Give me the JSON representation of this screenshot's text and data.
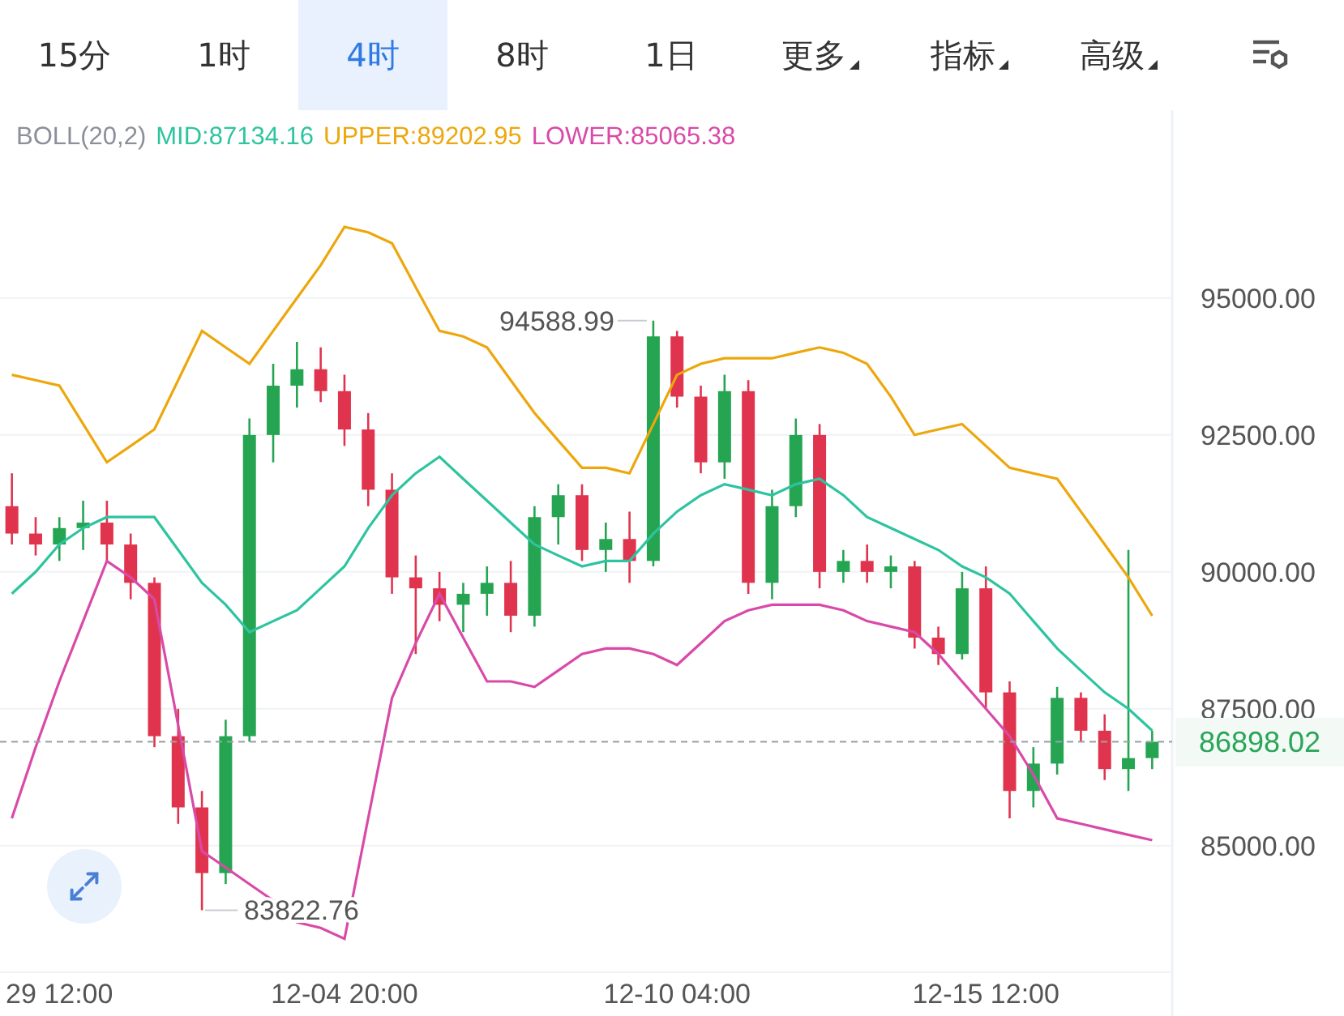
{
  "toolbar": {
    "tabs": [
      {
        "label": "15分",
        "kind": "interval",
        "selected": false
      },
      {
        "label": "1时",
        "kind": "interval",
        "selected": false
      },
      {
        "label": "4时",
        "kind": "interval",
        "selected": true
      },
      {
        "label": "8时",
        "kind": "interval",
        "selected": false
      },
      {
        "label": "1日",
        "kind": "interval",
        "selected": false
      },
      {
        "label": "更多",
        "kind": "dropdown",
        "selected": false
      },
      {
        "label": "指标",
        "kind": "dropdown",
        "selected": false
      },
      {
        "label": "高级",
        "kind": "dropdown",
        "selected": false
      }
    ]
  },
  "indicator_legend": {
    "title": "BOLL(20,2)",
    "series_values": [
      ":87134.16",
      ":89202.95",
      ":85065.38"
    ]
  },
  "chart": {
    "chart_data": {
      "type": "candlestick",
      "grid": true,
      "categories": [
        null,
        null,
        "29 12:00",
        null,
        null,
        null,
        null,
        null,
        null,
        null,
        null,
        null,
        null,
        null,
        "12-04 20:00",
        null,
        null,
        null,
        null,
        null,
        null,
        null,
        null,
        null,
        null,
        null,
        null,
        null,
        "12-10 04:00",
        null,
        null,
        null,
        null,
        null,
        null,
        null,
        null,
        null,
        null,
        null,
        null,
        "12-15 12:00",
        null,
        null,
        null,
        null,
        null,
        null,
        null
      ],
      "ylim": [
        82690,
        98430
      ],
      "yticks": [
        {
          "value": 95000,
          "label": "95000.00"
        },
        {
          "value": 92500,
          "label": "92500.00"
        },
        {
          "value": 90000,
          "label": "90000.00"
        },
        {
          "value": 87500,
          "label": "87500.00"
        },
        {
          "value": 85000,
          "label": "85000.00"
        }
      ],
      "ohlc": [
        [
          91200,
          91800,
          90500,
          90700
        ],
        [
          90700,
          91000,
          90300,
          90500
        ],
        [
          90500,
          91000,
          90200,
          90800
        ],
        [
          90800,
          91300,
          90400,
          90900
        ],
        [
          90900,
          91300,
          90200,
          90500
        ],
        [
          90500,
          90700,
          89500,
          89800
        ],
        [
          89800,
          89900,
          86800,
          87000
        ],
        [
          87000,
          87500,
          85400,
          85700
        ],
        [
          85700,
          86000,
          83822.76,
          84500
        ],
        [
          84500,
          87300,
          84300,
          87000
        ],
        [
          87000,
          92800,
          86900,
          92500
        ],
        [
          92500,
          93800,
          92000,
          93400
        ],
        [
          93400,
          94200,
          93000,
          93700
        ],
        [
          93700,
          94100,
          93100,
          93300
        ],
        [
          93300,
          93600,
          92300,
          92600
        ],
        [
          92600,
          92900,
          91200,
          91500
        ],
        [
          91500,
          91800,
          89600,
          89900
        ],
        [
          89900,
          90300,
          88500,
          89700
        ],
        [
          89700,
          90000,
          89100,
          89400
        ],
        [
          89400,
          89800,
          88900,
          89600
        ],
        [
          89600,
          90100,
          89200,
          89800
        ],
        [
          89800,
          90200,
          88900,
          89200
        ],
        [
          89200,
          91200,
          89000,
          91000
        ],
        [
          91000,
          91600,
          90500,
          91400
        ],
        [
          91400,
          91600,
          90200,
          90400
        ],
        [
          90400,
          90900,
          90000,
          90600
        ],
        [
          90600,
          91100,
          89800,
          90200
        ],
        [
          90200,
          94588.99,
          90100,
          94300
        ],
        [
          94300,
          94400,
          93000,
          93200
        ],
        [
          93200,
          93400,
          91800,
          92000
        ],
        [
          92000,
          93600,
          91700,
          93300
        ],
        [
          93300,
          93500,
          89600,
          89800
        ],
        [
          89800,
          91500,
          89500,
          91200
        ],
        [
          91200,
          92800,
          91000,
          92500
        ],
        [
          92500,
          92700,
          89700,
          90000
        ],
        [
          90000,
          90400,
          89800,
          90200
        ],
        [
          90200,
          90500,
          89800,
          90000
        ],
        [
          90000,
          90300,
          89700,
          90100
        ],
        [
          90100,
          90200,
          88600,
          88800
        ],
        [
          88800,
          89000,
          88300,
          88500
        ],
        [
          88500,
          90000,
          88400,
          89700
        ],
        [
          89700,
          90100,
          87500,
          87800
        ],
        [
          87800,
          88000,
          85500,
          86000
        ],
        [
          86000,
          86800,
          85700,
          86500
        ],
        [
          86500,
          87900,
          86300,
          87700
        ],
        [
          87700,
          87800,
          86900,
          87100
        ],
        [
          87100,
          87400,
          86200,
          86400
        ],
        [
          86400,
          90400,
          86000,
          86600
        ],
        [
          86600,
          87100,
          86400,
          86898
        ]
      ],
      "series": [
        {
          "name": "MID",
          "type": "line",
          "color": "#2ec4a0",
          "values": [
            89600,
            90000,
            90500,
            90800,
            91000,
            91000,
            91000,
            90400,
            89800,
            89400,
            88900,
            89100,
            89300,
            89700,
            90100,
            90800,
            91400,
            91800,
            92100,
            91700,
            91300,
            90900,
            90500,
            90300,
            90100,
            90200,
            90200,
            90700,
            91100,
            91400,
            91600,
            91500,
            91400,
            91600,
            91700,
            91400,
            91000,
            90800,
            90600,
            90400,
            90100,
            89900,
            89600,
            89100,
            88600,
            88200,
            87800,
            87500,
            87100
          ]
        },
        {
          "name": "UPPER",
          "type": "line",
          "color": "#eda70c",
          "values": [
            93600,
            93500,
            93400,
            92700,
            92000,
            92300,
            92600,
            93500,
            94400,
            94100,
            93800,
            94400,
            95000,
            95600,
            96300,
            96200,
            96000,
            95200,
            94400,
            94300,
            94100,
            93500,
            92900,
            92400,
            91900,
            91900,
            91800,
            92700,
            93600,
            93800,
            93900,
            93900,
            93900,
            94000,
            94100,
            94000,
            93800,
            93200,
            92500,
            92600,
            92700,
            92300,
            91900,
            91800,
            91700,
            91100,
            90500,
            89900,
            89200
          ]
        },
        {
          "name": "LOWER",
          "type": "line",
          "color": "#d94aa8",
          "values": [
            85500,
            86800,
            88000,
            89100,
            90200,
            89900,
            89500,
            87200,
            84900,
            84600,
            84300,
            84000,
            83600,
            83500,
            83300,
            85500,
            87700,
            88700,
            89600,
            88800,
            88000,
            88000,
            87900,
            88200,
            88500,
            88600,
            88600,
            88500,
            88300,
            88700,
            89100,
            89300,
            89400,
            89400,
            89400,
            89300,
            89100,
            89000,
            88900,
            88500,
            88000,
            87500,
            87000,
            86300,
            85500,
            85400,
            85300,
            85200,
            85100
          ]
        }
      ],
      "annotations": [
        "94588.99",
        "83822.76"
      ],
      "ref_lines": [
        {
          "axis": "y",
          "value": 86898.02,
          "label": "86898.02"
        }
      ]
    }
  }
}
